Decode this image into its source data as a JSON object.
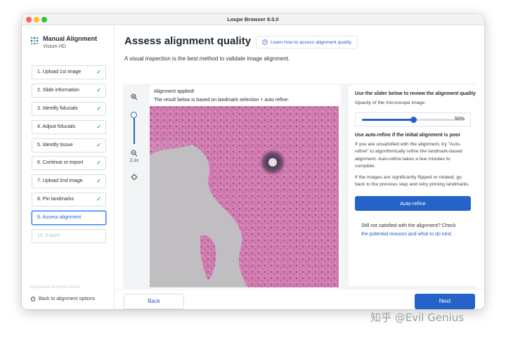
{
  "window": {
    "title": "Loupe Browser 8.0.0"
  },
  "app": {
    "title": "Manual Alignment",
    "subtitle": "Visium HD"
  },
  "steps": [
    {
      "label": "1. Upload 1st image",
      "state": "done"
    },
    {
      "label": "2. Slide information",
      "state": "done"
    },
    {
      "label": "3. Identify fiducials",
      "state": "done"
    },
    {
      "label": "4. Adjust fiducials",
      "state": "done"
    },
    {
      "label": "5. Identify tissue",
      "state": "done"
    },
    {
      "label": "6. Continue or export",
      "state": "done"
    },
    {
      "label": "7. Upload 2nd image",
      "state": "done"
    },
    {
      "label": "8. Pin landmarks",
      "state": "done"
    },
    {
      "label": "9. Assess alignment",
      "state": "active"
    },
    {
      "label": "10. Export",
      "state": "disabled"
    }
  ],
  "sidebar_footer": {
    "keyboard_shortcuts": "Keyboard shortcut sheet",
    "back_to_options": "Back to alignment options"
  },
  "main": {
    "title": "Assess alignment quality",
    "learn_link": "Learn how to assess alignment quality",
    "subtitle": "A visual inspection is the best method to validate image alignment."
  },
  "viewer": {
    "zoom_level": "2.1x",
    "caption_line1": "Alignment applied!",
    "caption_line2": "The result below is based on landmark selection + auto refine."
  },
  "review": {
    "heading": "Use the slider below to review the alignment quality",
    "opacity_label": "Opacity of the microscope image:",
    "opacity_value": 0.5,
    "opacity_text": "50%",
    "autorefine_heading": "Use auto-refine if the initial alignment is poor",
    "autorefine_desc": "If you are unsatisfied with the alignment, try \"Auto-refine\" to algorithmically refine the landmark-based alignment. Auto-refine takes a few minutes to complete.",
    "flipped_desc": "If the images are significantly flipped or rotated, go back to the previous step and retry pinning landmarks.",
    "autorefine_button": "Auto-refine",
    "not_satisfied": "Still not satisfied with the alignment? Check",
    "reasons_link": "the potential reasons and what to do next."
  },
  "footer": {
    "back": "Back",
    "next": "Next"
  },
  "watermark": "知乎 @Evil Genius",
  "colors": {
    "accent": "#2563c9",
    "done": "#2bb673",
    "tissue": "#c85a98"
  }
}
